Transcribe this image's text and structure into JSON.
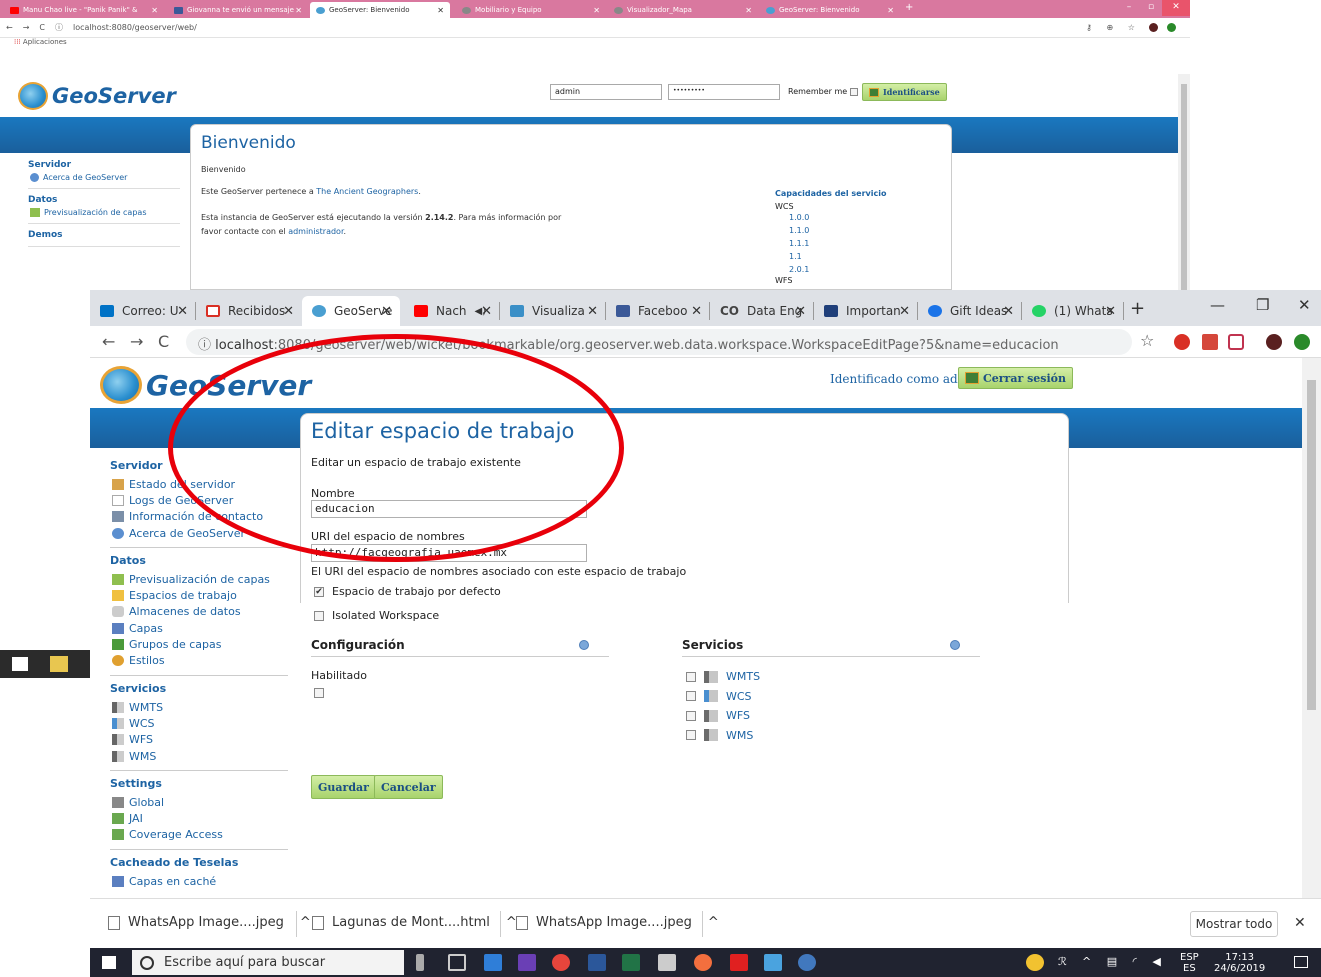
{
  "back_window": {
    "tabs": [
      {
        "label": "Manu Chao live - \"Panik Panik\" &",
        "color": "#ff0000"
      },
      {
        "label": "Giovanna te envió un mensaje",
        "color": "#3b5998"
      },
      {
        "label": "GeoServer: Bienvenido",
        "color": "#4a9fd1"
      },
      {
        "label": "Mobiliario y Equipo",
        "color": "#777777"
      },
      {
        "label": "Visualizador_Mapa",
        "color": "#777777"
      },
      {
        "label": "GeoServer: Bienvenido",
        "color": "#4a9fd1"
      }
    ],
    "url": "localhost:8080/geoserver/web/",
    "bookmarks_label": "Aplicaciones",
    "logo_text": "GeoServer",
    "username": "admin",
    "password_mask": "•••••••••",
    "remember_label": "Remember me",
    "login_button": "Identificarse",
    "sidebar": {
      "servidor": "Servidor",
      "acerca": "Acerca de GeoServer",
      "datos": "Datos",
      "preview": "Previsualización de capas",
      "demos": "Demos"
    },
    "panel": {
      "title": "Bienvenido",
      "subtitle": "Bienvenido",
      "owner_prefix": "Este GeoServer pertenece a ",
      "owner_link": "The Ancient Geographers",
      "owner_suffix": ".",
      "version_prefix": "Esta instancia de GeoServer está ejecutando la versión ",
      "version": "2.14.2",
      "version_suffix": ". Para más información por",
      "contact_prefix": "favor contacte con el ",
      "contact_link": "administrador",
      "contact_suffix": "."
    },
    "capabilities": {
      "title": "Capacidades del servicio",
      "service": "WCS",
      "versions": [
        "1.0.0",
        "1.1.0",
        "1.1.1",
        "1.1",
        "2.0.1"
      ],
      "next_service": "WFS"
    }
  },
  "front_window": {
    "tabs": [
      {
        "label": "Correo: U",
        "color": "#0072c6"
      },
      {
        "label": "Recibidos",
        "color": "#d93025"
      },
      {
        "label": "GeoServe",
        "color": "#4a9fd1"
      },
      {
        "label": "Nach",
        "color": "#ff0000"
      },
      {
        "label": "Visualiza",
        "color": "#3a8fc7"
      },
      {
        "label": "Faceboo",
        "color": "#3b5998"
      },
      {
        "label": "Data Eng",
        "color": "#555555"
      },
      {
        "label": "Importan",
        "color": "#1f3f7a"
      },
      {
        "label": "Gift Ideas",
        "color": "#1a73e8"
      },
      {
        "label": "(1) Whats",
        "color": "#25d366"
      }
    ],
    "url_host": "localhost",
    "url_rest": ":8080/geoserver/web/wicket/bookmarkable/org.geoserver.web.data.workspace.WorkspaceEditPage?5&name=educacion",
    "logo_text": "GeoServer",
    "identified_as": "Identificado como admin.",
    "logout_button": "Cerrar sesión",
    "sidebar": {
      "sections": [
        {
          "title": "Servidor",
          "items": [
            {
              "label": "Estado del servidor",
              "color": "#d8a34a"
            },
            {
              "label": "Logs de GeoServer",
              "color": "#dddddd"
            },
            {
              "label": "Información de contacto",
              "color": "#7b8fa8"
            },
            {
              "label": "Acerca de GeoServer",
              "color": "#5b8fd0"
            }
          ]
        },
        {
          "title": "Datos",
          "items": [
            {
              "label": "Previsualización de capas",
              "color": "#8fbf4f"
            },
            {
              "label": "Espacios de trabajo",
              "color": "#f0c040"
            },
            {
              "label": "Almacenes de datos",
              "color": "#cccccc"
            },
            {
              "label": "Capas",
              "color": "#5b7fc0"
            },
            {
              "label": "Grupos de capas",
              "color": "#4a9a3a"
            },
            {
              "label": "Estilos",
              "color": "#e0a030"
            }
          ]
        },
        {
          "title": "Servicios",
          "items": [
            {
              "label": "WMTS",
              "color": "#777777"
            },
            {
              "label": "WCS",
              "color": "#4a8fd0"
            },
            {
              "label": "WFS",
              "color": "#777777"
            },
            {
              "label": "WMS",
              "color": "#777777"
            }
          ]
        },
        {
          "title": "Settings",
          "items": [
            {
              "label": "Global",
              "color": "#888888"
            },
            {
              "label": "JAI",
              "color": "#6aa84f"
            },
            {
              "label": "Coverage Access",
              "color": "#6aa84f"
            }
          ]
        },
        {
          "title": "Cacheado de Teselas",
          "items": [
            {
              "label": "Capas en caché",
              "color": "#5b7fc0"
            }
          ]
        }
      ]
    },
    "form": {
      "title": "Editar espacio de trabajo",
      "subtitle": "Editar un espacio de trabajo existente",
      "name_label": "Nombre",
      "name_value": "educacion",
      "uri_label": "URI del espacio de nombres",
      "uri_value": "http://facgeografia.uaemex.mx",
      "uri_help": "El URI del espacio de nombres asociado con este espacio de trabajo",
      "default_ws_label": "Espacio de trabajo por defecto",
      "default_ws_checked": true,
      "isolated_label": "Isolated Workspace",
      "isolated_checked": false,
      "config_title": "Configuración",
      "enabled_label": "Habilitado",
      "enabled_checked": false,
      "services_title": "Servicios",
      "services": [
        {
          "label": "WMTS",
          "checked": false
        },
        {
          "label": "WCS",
          "checked": false
        },
        {
          "label": "WFS",
          "checked": false
        },
        {
          "label": "WMS",
          "checked": false
        }
      ],
      "save_button": "Guardar",
      "cancel_button": "Cancelar"
    },
    "downloads": [
      {
        "label": "WhatsApp Image....jpeg"
      },
      {
        "label": "Lagunas de Mont....html"
      },
      {
        "label": "WhatsApp Image....jpeg"
      }
    ],
    "show_all": "Mostrar todo"
  },
  "taskbar": {
    "search_placeholder": "Escribe aquí para buscar",
    "lang_top": "ESP",
    "lang_bottom": "ES",
    "time": "17:13",
    "date": "24/6/2019"
  },
  "colors": {
    "brand_blue": "#1d63a3",
    "band_blue": "#1a78c0",
    "button_green": "#a8d36c",
    "annotation_red": "#e8000a"
  }
}
